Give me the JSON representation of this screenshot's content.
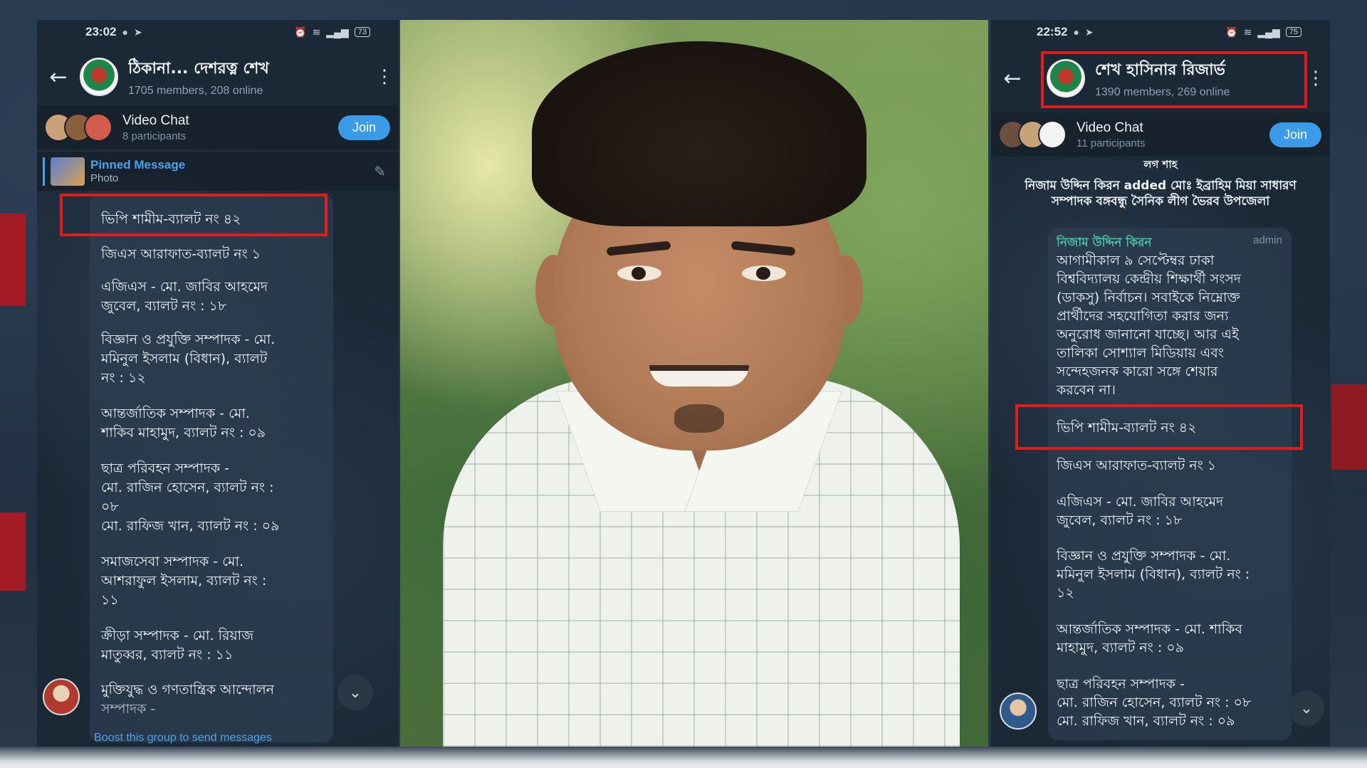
{
  "left_phone": {
    "status": {
      "time": "23:02",
      "battery": "73"
    },
    "header": {
      "title": "ঠিকানা... দেশরত্ন শেখ",
      "subtitle": "1705 members, 208 online"
    },
    "video_chat": {
      "title": "Video Chat",
      "subtitle": "8 participants",
      "join": "Join"
    },
    "pinned": {
      "title": "Pinned Message",
      "subtitle": "Photo"
    },
    "messages": [
      "ভিপি শামীম-ব্যালট নং ৪২",
      "জিএস আরাফাত-ব্যালট নং ১",
      "এজিএস - মো. জাবির আহমেদ",
      "জুবেল, ব্যালট নং : ১৮",
      "বিজ্ঞান ও প্রযুক্তি সম্পাদক - মো.",
      "মমিনুল ইসলাম (বিধান), ব্যালট",
      "নং : ১২",
      "আন্তর্জাতিক সম্পাদক - মো.",
      "শাকিব মাহামুদ, ব্যালট নং : ০৯",
      "ছাত্র পরিবহন সম্পাদক -",
      "মো. রাজিন হোসেন, ব্যালট নং :",
      "০৮",
      "মো. রাফিজ খান, ব্যালট নং : ০৯",
      "সমাজসেবা সম্পাদক - মো.",
      "আশরাফুল ইসলাম, ব্যালট নং :",
      "১১",
      "ক্রীড়া সম্পাদক - মো. রিয়াজ",
      "মাতুব্বর, ব্যালট নং : ১১",
      "মুক্তিযুদ্ধ ও গণতান্ত্রিক আন্দোলন",
      "সম্পাদক -"
    ],
    "boost": "Boost this group to send messages"
  },
  "right_phone": {
    "status": {
      "time": "22:52",
      "battery": "75"
    },
    "header": {
      "title": "শেখ হাসিনার রিজার্ভ",
      "subtitle": "1390 members, 269 online"
    },
    "video_chat": {
      "title": "Video Chat",
      "subtitle": "11 participants",
      "join": "Join"
    },
    "service_top": "লগ শাহ",
    "service_msg_1": "নিজাম উদ্দিন কিরন added মোঃ ইব্রাহিম মিয়া সাধারণ",
    "service_msg_2": "সম্পাদক বঙ্গবন্ধু সৈনিক লীগ ভৈরব উপজেলা",
    "sender": "নিজাম উদ্দিন কিরন",
    "admin": "admin",
    "messages": [
      "আগামীকাল ৯ সেপ্টেম্বর ঢাকা",
      "বিশ্ববিদ্যালয় কেন্দ্রীয় শিক্ষার্থী সংসদ",
      "(ডাকসু) নির্বাচন। সবাইকে নিম্নোক্ত",
      "প্রার্থীদের সহযোগিতা করার জন্য",
      "অনুরোধ জানানো যাচ্ছে। আর এই",
      "তালিকা সোশ্যাল মিডিয়ায় এবং",
      "সন্দেহজনক কারো সঙ্গে শেয়ার",
      "করবেন না।",
      "ভিপি শামীম-ব্যালট নং ৪২",
      "জিএস আরাফাত-ব্যালট নং ১",
      "এজিএস - মো. জাবির আহমেদ",
      "জুবেল, ব্যালট নং : ১৮",
      "বিজ্ঞান ও প্রযুক্তি সম্পাদক - মো.",
      "মমিনুল ইসলাম (বিধান), ব্যালট নং :",
      "১২",
      "আন্তর্জাতিক সম্পাদক - মো. শাকিব",
      "মাহামুদ, ব্যালট নং : ০৯",
      "ছাত্র পরিবহন সম্পাদক -",
      "মো. রাজিন হোসেন, ব্যালট নং : ০৮",
      "মো. রাফিজ খান, ব্যালট নং : ০৯"
    ]
  },
  "icons": {
    "back": "back-arrow-icon",
    "menu": "kebab-menu-icon",
    "scroll": "chevron-down-icon",
    "pin": "pin-list-icon"
  },
  "colors": {
    "highlight": "#e21b1b",
    "accent": "#3c9be8",
    "chat_bg": "#17212b"
  }
}
